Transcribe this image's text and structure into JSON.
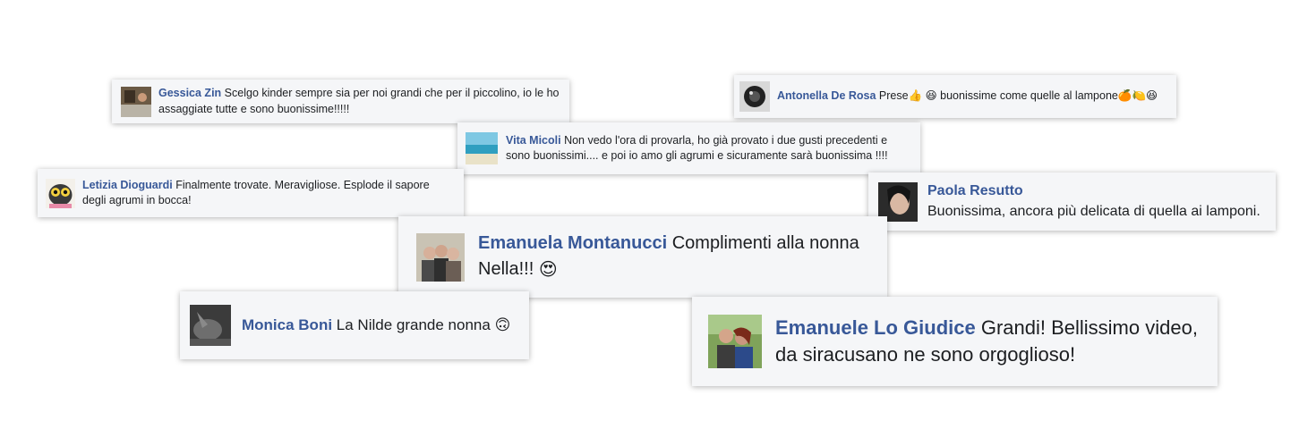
{
  "comments": {
    "gessica": {
      "name": "Gessica Zin",
      "text": "Scelgo kinder sempre sia per noi grandi che per il piccolino, io le ho assaggiate tutte e sono buonissime!!!!!",
      "avatar_icon": "avatar-photo-icon"
    },
    "antonella": {
      "name": "Antonella De Rosa",
      "text_before": "Prese",
      "text_middle": " buonissime come quelle al lampone",
      "emoji_1": "👍",
      "emoji_2": "😆",
      "emoji_3": "🍊",
      "emoji_4": "🍋",
      "emoji_5": "😆",
      "avatar_icon": "avatar-photo-icon"
    },
    "vita": {
      "name": "Vita Micoli",
      "text": "Non vedo l'ora di provarla, ho già provato i due gusti precedenti e sono buonissimi.... e poi io amo gli agrumi e sicuramente sarà buonissima !!!!",
      "avatar_icon": "avatar-beach-icon"
    },
    "letizia": {
      "name": "Letizia Dioguardi",
      "text": "Finalmente trovate. Meravigliose. Esplode il sapore degli agrumi in bocca!",
      "avatar_icon": "avatar-owl-icon"
    },
    "paola": {
      "name": "Paola Resutto",
      "text": "Buonissima, ancora più delicata di quella ai lamponi.",
      "avatar_icon": "avatar-photo-icon"
    },
    "emanuela": {
      "name": "Emanuela Montanucci",
      "text": "Complimenti alla nonna Nella!!!",
      "emoji": "😍",
      "avatar_icon": "avatar-group-photo-icon"
    },
    "monica": {
      "name": "Monica Boni",
      "text": "La Nilde grande nonna",
      "emoji": "🙃",
      "avatar_icon": "avatar-photo-icon"
    },
    "emanuele": {
      "name": "Emanuele Lo Giudice",
      "text": "Grandi! Bellissimo video, da siracusano ne sono orgoglioso!",
      "avatar_icon": "avatar-couple-photo-icon"
    }
  },
  "colors": {
    "name": "#385898",
    "text": "#1c1e21",
    "card_bg": "#f5f6f8"
  }
}
